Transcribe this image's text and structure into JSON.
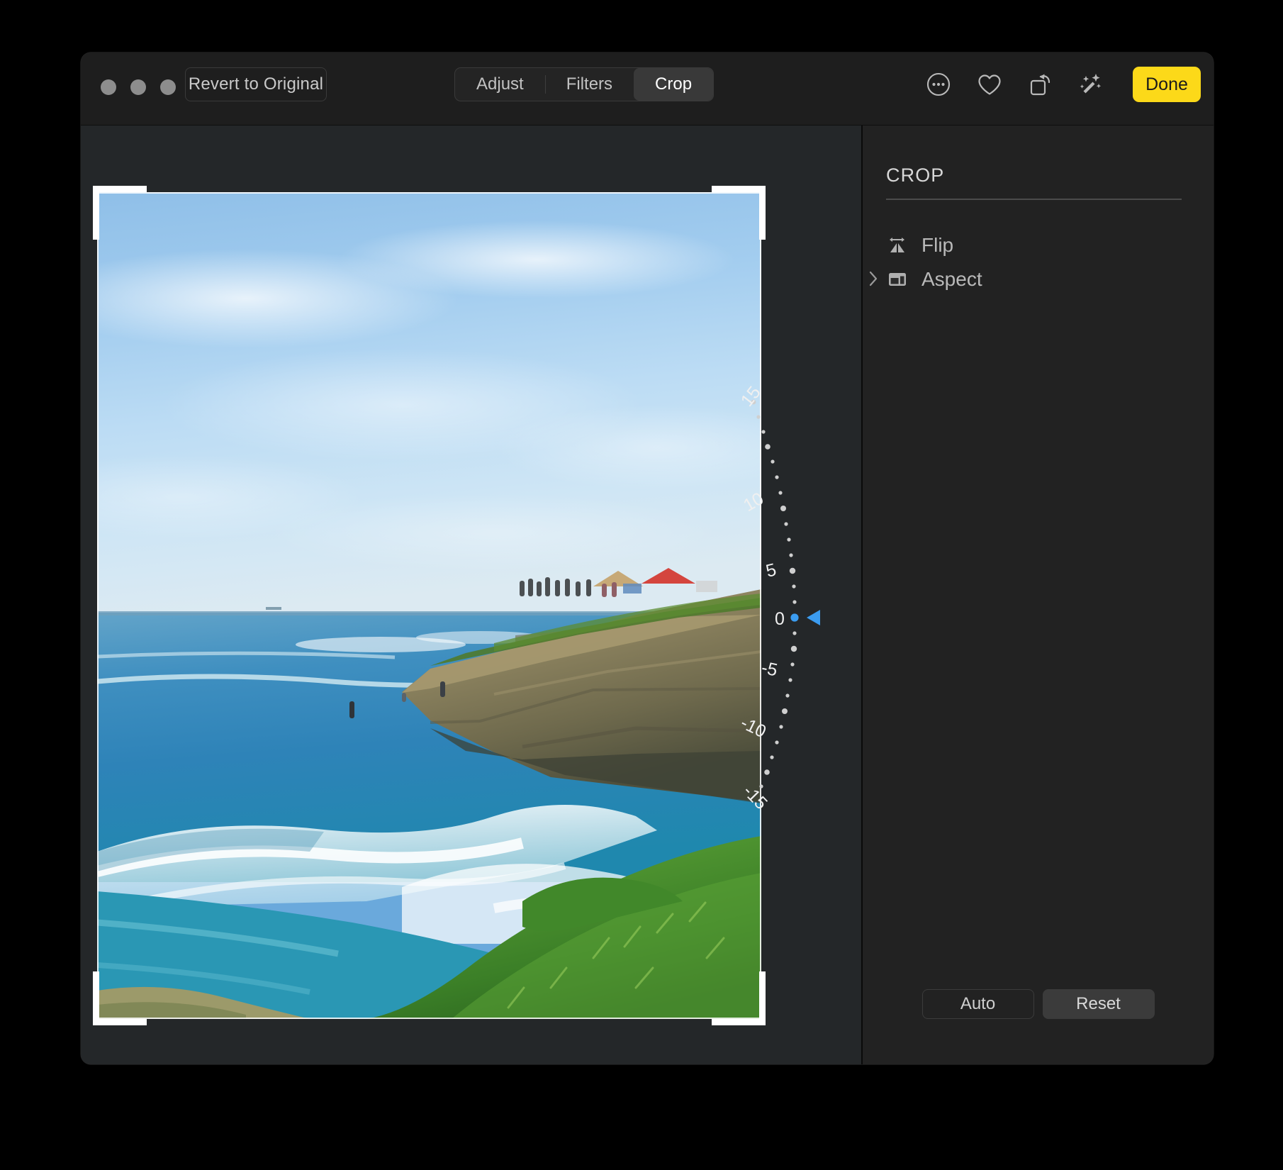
{
  "window": {
    "traffic_lights": [
      "close",
      "minimize",
      "zoom"
    ],
    "revert_label": "Revert to Original"
  },
  "toolbar": {
    "segments": [
      {
        "label": "Adjust",
        "selected": false
      },
      {
        "label": "Filters",
        "selected": false
      },
      {
        "label": "Crop",
        "selected": true
      }
    ],
    "icons": [
      {
        "name": "more-options-icon",
        "glyph": "ellipsis-circle"
      },
      {
        "name": "favorite-heart-icon",
        "glyph": "heart"
      },
      {
        "name": "rotate-icon",
        "glyph": "rotate-ccw"
      },
      {
        "name": "auto-enhance-icon",
        "glyph": "magic-wand"
      }
    ],
    "done_label": "Done",
    "done_color": "#fcd919"
  },
  "inspector": {
    "title": "CROP",
    "rows": [
      {
        "label": "Flip",
        "icon": "flip-icon",
        "has_disclosure": false
      },
      {
        "label": "Aspect",
        "icon": "aspect-icon",
        "has_disclosure": true
      }
    ],
    "footer": {
      "auto_label": "Auto",
      "reset_label": "Reset"
    }
  },
  "rotation_dial": {
    "value": 0,
    "unit": "degrees",
    "indicator_color": "#3b9cf0",
    "tick_labels": [
      "15",
      "10",
      "5",
      "0",
      "-5",
      "-10",
      "-15"
    ],
    "tick_values": [
      15,
      10,
      5,
      0,
      -5,
      -10,
      -15
    ]
  },
  "photo": {
    "alt": "Coastal sandstone cliff with ocean waves and ice plant groundcover, canopy tents and people on the bluff",
    "crop_handles": [
      "top-left",
      "top-right",
      "bottom-left",
      "bottom-right"
    ]
  }
}
